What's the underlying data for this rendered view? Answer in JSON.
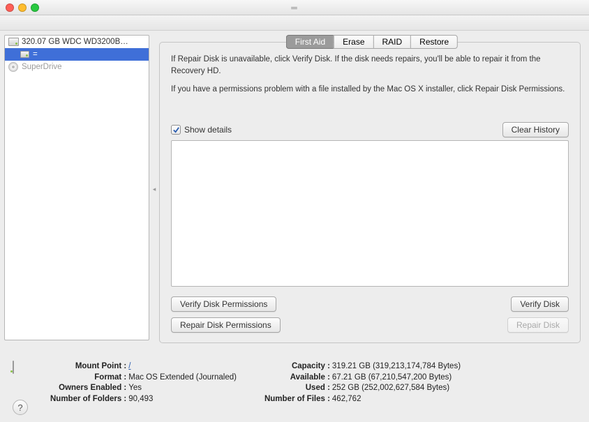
{
  "sidebar": {
    "items": [
      {
        "label": "320.07 GB WDC WD3200B…"
      },
      {
        "label": "="
      },
      {
        "label": "SuperDrive"
      }
    ]
  },
  "tabs": {
    "items": [
      "First Aid",
      "Erase",
      "RAID",
      "Restore"
    ],
    "active": 0
  },
  "instructions": {
    "p1": "If Repair Disk is unavailable, click Verify Disk. If the disk needs repairs, you'll be able to repair it from the Recovery HD.",
    "p2": "If you have a permissions problem with a file installed by the Mac OS X installer, click Repair Disk Permissions."
  },
  "details": {
    "show_label": "Show details",
    "checked": true,
    "clear_history": "Clear History"
  },
  "buttons": {
    "verify_perm": "Verify Disk Permissions",
    "repair_perm": "Repair Disk Permissions",
    "verify_disk": "Verify Disk",
    "repair_disk": "Repair Disk"
  },
  "info": {
    "left": {
      "mount_point_label": "Mount Point :",
      "mount_point_value": "/",
      "format_label": "Format :",
      "format_value": "Mac OS Extended (Journaled)",
      "owners_label": "Owners Enabled :",
      "owners_value": "Yes",
      "folders_label": "Number of Folders :",
      "folders_value": "90,493"
    },
    "right": {
      "capacity_label": "Capacity :",
      "capacity_value": "319.21 GB (319,213,174,784 Bytes)",
      "available_label": "Available :",
      "available_value": "67.21 GB (67,210,547,200 Bytes)",
      "used_label": "Used :",
      "used_value": "252 GB (252,002,627,584 Bytes)",
      "files_label": "Number of Files :",
      "files_value": "462,762"
    }
  },
  "help": "?"
}
